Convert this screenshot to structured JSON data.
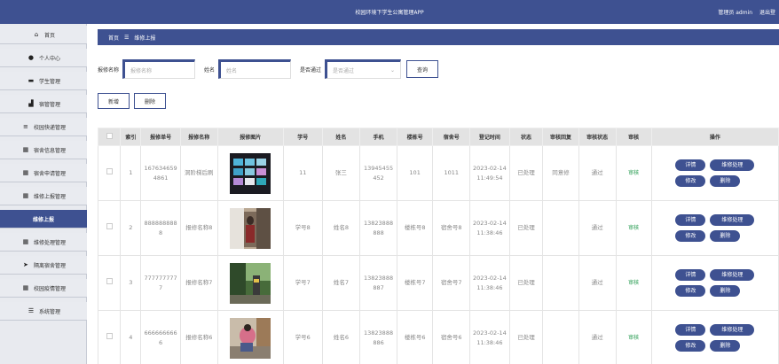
{
  "app": {
    "title": "校园环境下学生公寓管理APP",
    "admin_label": "管理员 admin",
    "logout_label": "退出登"
  },
  "sidebar": {
    "items": [
      {
        "label": "首页",
        "icon": "home-icon",
        "glyph": "⌂"
      },
      {
        "label": "个人中心",
        "icon": "user-icon",
        "glyph": "●"
      },
      {
        "label": "学生管理",
        "icon": "monitor-icon",
        "glyph": "▬"
      },
      {
        "label": "宿管管理",
        "icon": "thumbs-up-icon",
        "glyph": "▟"
      },
      {
        "label": "校园快递管理",
        "icon": "list-icon",
        "glyph": "≡"
      },
      {
        "label": "宿舍信息管理",
        "icon": "grid-icon",
        "glyph": "▦"
      },
      {
        "label": "宿舍申请管理",
        "icon": "grid-icon",
        "glyph": "▦"
      },
      {
        "label": "维修上报管理",
        "icon": "grid-icon",
        "glyph": "▦"
      },
      {
        "label": "维修上报",
        "icon": "",
        "glyph": ""
      },
      {
        "label": "维修处理管理",
        "icon": "grid-icon",
        "glyph": "▦"
      },
      {
        "label": "隔离宿舍管理",
        "icon": "send-icon",
        "glyph": "➤"
      },
      {
        "label": "校园疫情管理",
        "icon": "grid-icon",
        "glyph": "▦"
      },
      {
        "label": "系统管理",
        "icon": "sliders-icon",
        "glyph": "☰"
      }
    ]
  },
  "breadcrumb": {
    "home": "首页",
    "separator": "☰",
    "current": "维修上报"
  },
  "search": {
    "name_label": "报修名称",
    "name_placeholder": "报修名称",
    "person_label": "姓名",
    "person_placeholder": "姓名",
    "passed_label": "是否通过",
    "passed_placeholder": "是否通过",
    "query_button": "查询"
  },
  "actions": {
    "add": "新增",
    "delete": "删除"
  },
  "table": {
    "headers": [
      "",
      "索引",
      "报修单号",
      "报修名称",
      "报修图片",
      "学号",
      "姓名",
      "手机",
      "楼栋号",
      "宿舍号",
      "登记时间",
      "状态",
      "审核回复",
      "审核状态",
      "审核",
      "操作"
    ],
    "rows": [
      {
        "index": "1",
        "order_no": "1676346594861",
        "name": "洞阶梯后刷",
        "student_no": "11",
        "student_name": "张三",
        "phone": "13945455452",
        "building": "101",
        "room": "1011",
        "time": "2023-02-14 11:49:54",
        "status": "已处理",
        "reply": "同意修",
        "audit_status": "通过",
        "audit": "审核"
      },
      {
        "index": "2",
        "order_no": "8888888888",
        "name": "报修名称8",
        "student_no": "学号8",
        "student_name": "姓名8",
        "phone": "13823888888",
        "building": "楼栋号8",
        "room": "宿舍号8",
        "time": "2023-02-14 11:38:46",
        "status": "已处理",
        "reply": "",
        "audit_status": "通过",
        "audit": "审核"
      },
      {
        "index": "3",
        "order_no": "7777777777",
        "name": "报修名称7",
        "student_no": "学号7",
        "student_name": "姓名7",
        "phone": "13823888887",
        "building": "楼栋号7",
        "room": "宿舍号7",
        "time": "2023-02-14 11:38:46",
        "status": "已处理",
        "reply": "",
        "audit_status": "通过",
        "audit": "审核"
      },
      {
        "index": "4",
        "order_no": "6666666666",
        "name": "报修名称6",
        "student_no": "学号6",
        "student_name": "姓名6",
        "phone": "13823888886",
        "building": "楼栋号6",
        "room": "宿舍号6",
        "time": "2023-02-14 11:38:46",
        "status": "已处理",
        "reply": "",
        "audit_status": "通过",
        "audit": "审核"
      }
    ],
    "ops": {
      "detail": "详情",
      "process": "维修处理",
      "edit": "修改",
      "delete": "删除"
    }
  },
  "colors": {
    "primary": "#3e5191",
    "audit_green": "#2a9d53",
    "sidebar_bg": "#e9ebf0",
    "header_bg": "#e3e3e3"
  }
}
